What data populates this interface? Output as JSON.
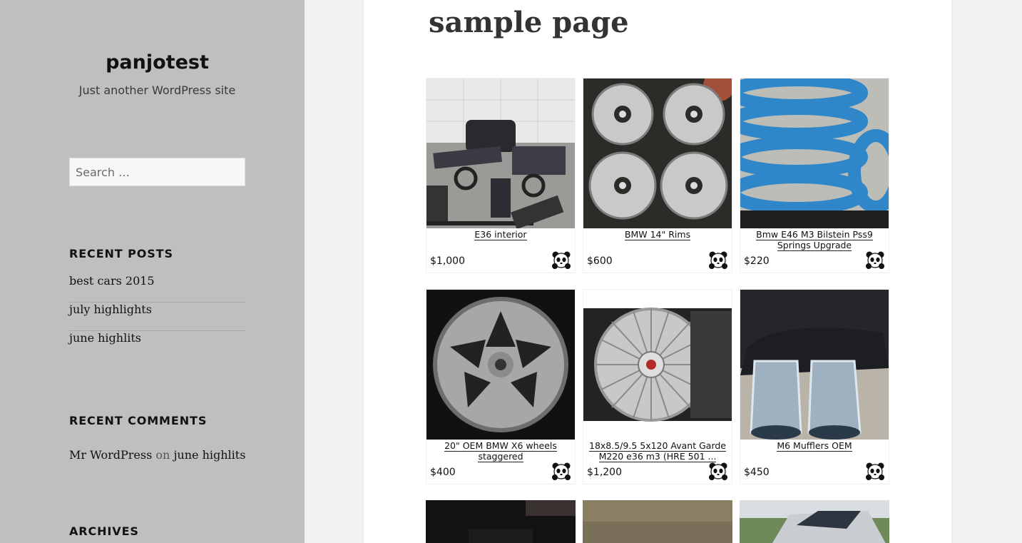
{
  "site": {
    "title": "panjotest",
    "tagline": "Just another WordPress site"
  },
  "search": {
    "placeholder": "Search …"
  },
  "recent_posts": {
    "heading": "RECENT POSTS",
    "items": [
      "best cars 2015",
      "july highlights",
      "june highlits"
    ]
  },
  "recent_comments": {
    "heading": "RECENT COMMENTS",
    "author": "Mr WordPress",
    "connector": "on",
    "post": "june highlits"
  },
  "archives": {
    "heading": "ARCHIVES"
  },
  "page": {
    "title": "sample page"
  },
  "listings": [
    {
      "title": "E36 interior",
      "price": "$1,000",
      "image": "car-interior-parts"
    },
    {
      "title": "BMW 14\" Rims",
      "price": "$600",
      "image": "four-silver-rims"
    },
    {
      "title": "Bmw E46 M3 Bilstein Pss9 Springs Upgrade",
      "price": "$220",
      "image": "blue-coil-springs"
    },
    {
      "title": "20\" OEM BMW X6 wheels staggered",
      "price": "$400",
      "image": "silver-wheel"
    },
    {
      "title": "18x8.5/9.5 5x120 Avant Garde M220 e36 m3 (HRE 501 ...",
      "price": "$1,200",
      "image": "mesh-wheel"
    },
    {
      "title": "M6 Mufflers OEM",
      "price": "$450",
      "image": "chrome-mufflers"
    }
  ],
  "colors": {
    "sidebar_bg": "#bfbfbf",
    "page_bg": "#f1f1f1",
    "content_bg": "#ffffff",
    "spring_blue": "#2f86c8"
  },
  "icons": {
    "listing_badge": "panda-icon"
  }
}
